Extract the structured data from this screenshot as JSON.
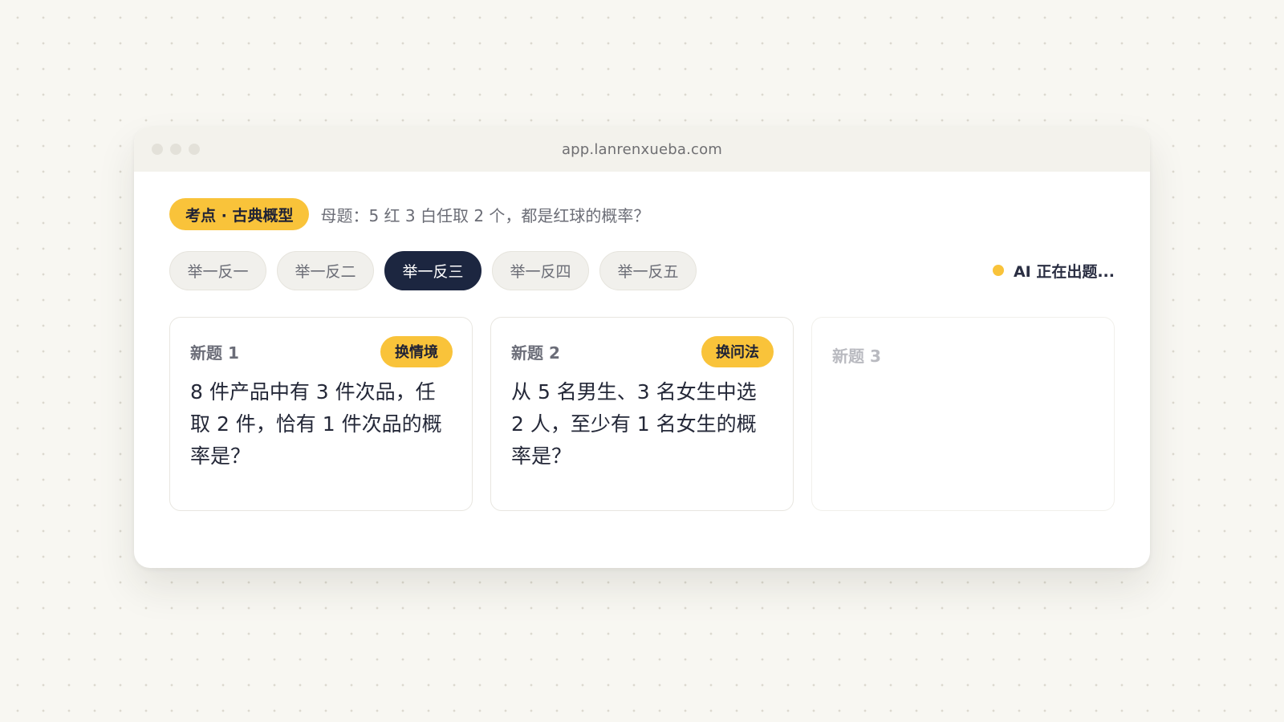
{
  "browser": {
    "url": "app.lanrenxueba.com"
  },
  "header": {
    "topic_badge": "考点 · 古典概型",
    "mother_question": "母题：5 红 3 白任取 2 个，都是红球的概率？"
  },
  "tabs": [
    {
      "label": "举一反一",
      "active": false
    },
    {
      "label": "举一反二",
      "active": false
    },
    {
      "label": "举一反三",
      "active": true
    },
    {
      "label": "举一反四",
      "active": false
    },
    {
      "label": "举一反五",
      "active": false
    }
  ],
  "status": {
    "text": "AI 正在出题..."
  },
  "cards": [
    {
      "title": "新题 1",
      "tag": "换情境",
      "body": "8 件产品中有 3 件次品，任取 2 件，恰有 1 件次品的概率是？"
    },
    {
      "title": "新题 2",
      "tag": "换问法",
      "body": "从 5 名男生、3 名女生中选 2 人，至少有 1 名女生的概率是？"
    },
    {
      "title": "新题 3"
    }
  ],
  "colors": {
    "accent_yellow": "#f9c33a",
    "active_tab": "#1c2640",
    "background": "#f8f7f2"
  }
}
